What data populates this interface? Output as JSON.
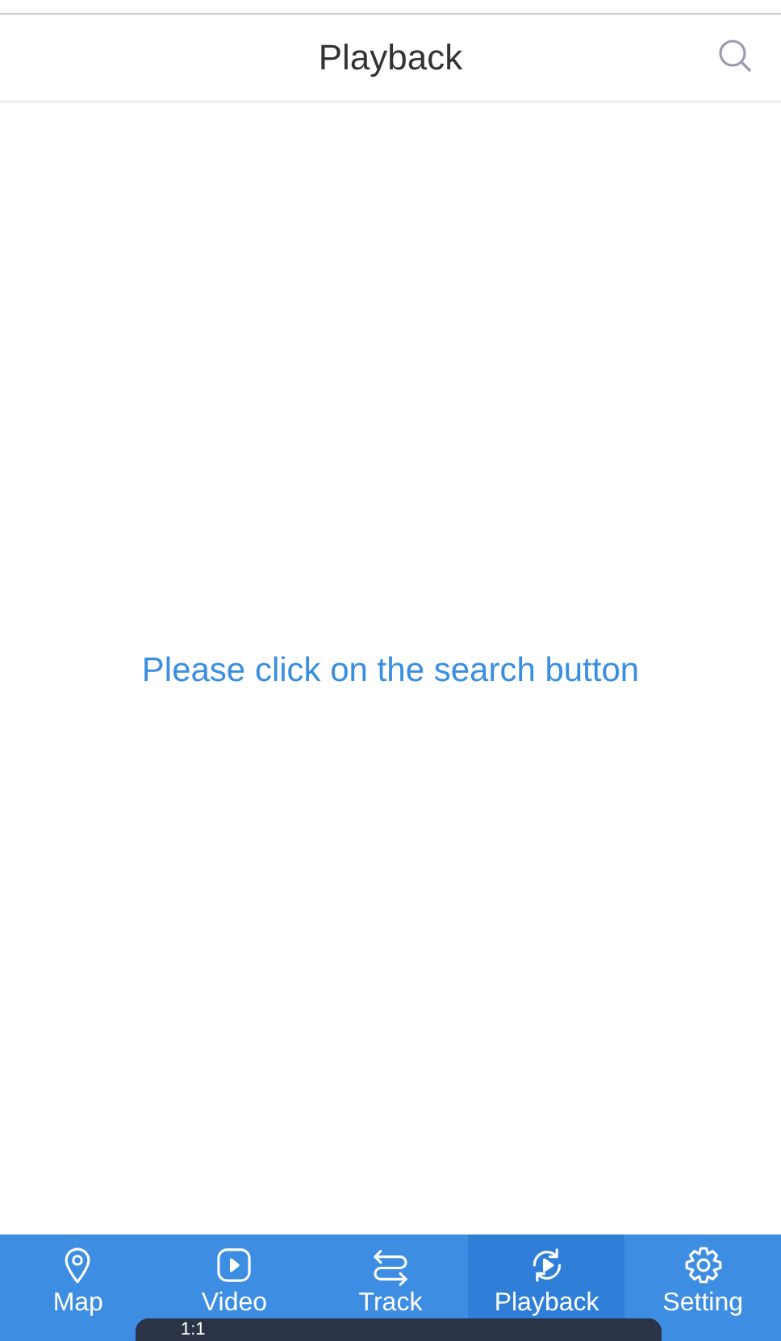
{
  "header": {
    "title": "Playback"
  },
  "message": "Please click on the search button",
  "tabs": [
    {
      "label": "Map",
      "kind": "pin",
      "selected": false
    },
    {
      "label": "Video",
      "kind": "play",
      "selected": false
    },
    {
      "label": "Track",
      "kind": "arrows",
      "selected": false
    },
    {
      "label": "Playback",
      "kind": "replay",
      "selected": true
    },
    {
      "label": "Setting",
      "kind": "gear",
      "selected": false
    }
  ],
  "viewer_toolbar": {
    "zoom_label": "1:1"
  }
}
